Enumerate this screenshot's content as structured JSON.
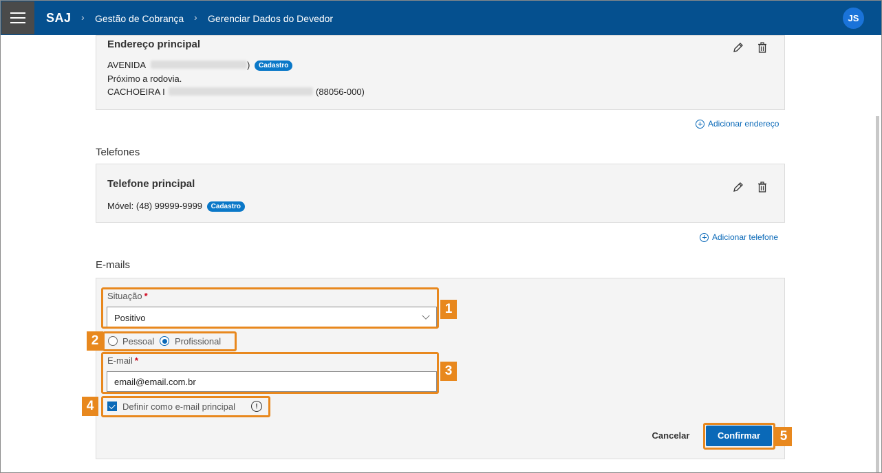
{
  "header": {
    "app_name": "SAJ",
    "breadcrumb_sep": "›",
    "breadcrumbs": [
      "Gestão de Cobrança",
      "Gerenciar Dados do Devedor"
    ],
    "avatar_initials": "JS",
    "color": "#05508f"
  },
  "address": {
    "card_title": "Endereço principal",
    "line1_prefix": "AVENIDA",
    "line1_suffix": ")",
    "badge": "Cadastro",
    "line2": "Próximo a rodovia.",
    "line3_prefix": "CACHOEIRA I",
    "line3_suffix": "(88056-000)",
    "add_link": "Adicionar endereço"
  },
  "phones": {
    "section_title": "Telefones",
    "card_title": "Telefone principal",
    "line1": "Móvel: (48) 99999-9999",
    "badge": "Cadastro",
    "add_link": "Adicionar telefone"
  },
  "emails": {
    "section_title": "E-mails",
    "situacao_label": "Situação",
    "required_mark": "*",
    "situacao_value": "Positivo",
    "radio_options": [
      {
        "label": "Pessoal",
        "selected": false
      },
      {
        "label": "Profissional",
        "selected": true
      }
    ],
    "email_label": "E-mail",
    "email_value": "email@email.com.br",
    "checkbox_label": "Definir como e-mail principal",
    "checkbox_checked": true,
    "info_glyph": "!",
    "cancel_label": "Cancelar",
    "confirm_label": "Confirmar"
  },
  "callouts": [
    "1",
    "2",
    "3",
    "4",
    "5"
  ],
  "accent_color": "#e8881e",
  "primary_color": "#0a69b8"
}
